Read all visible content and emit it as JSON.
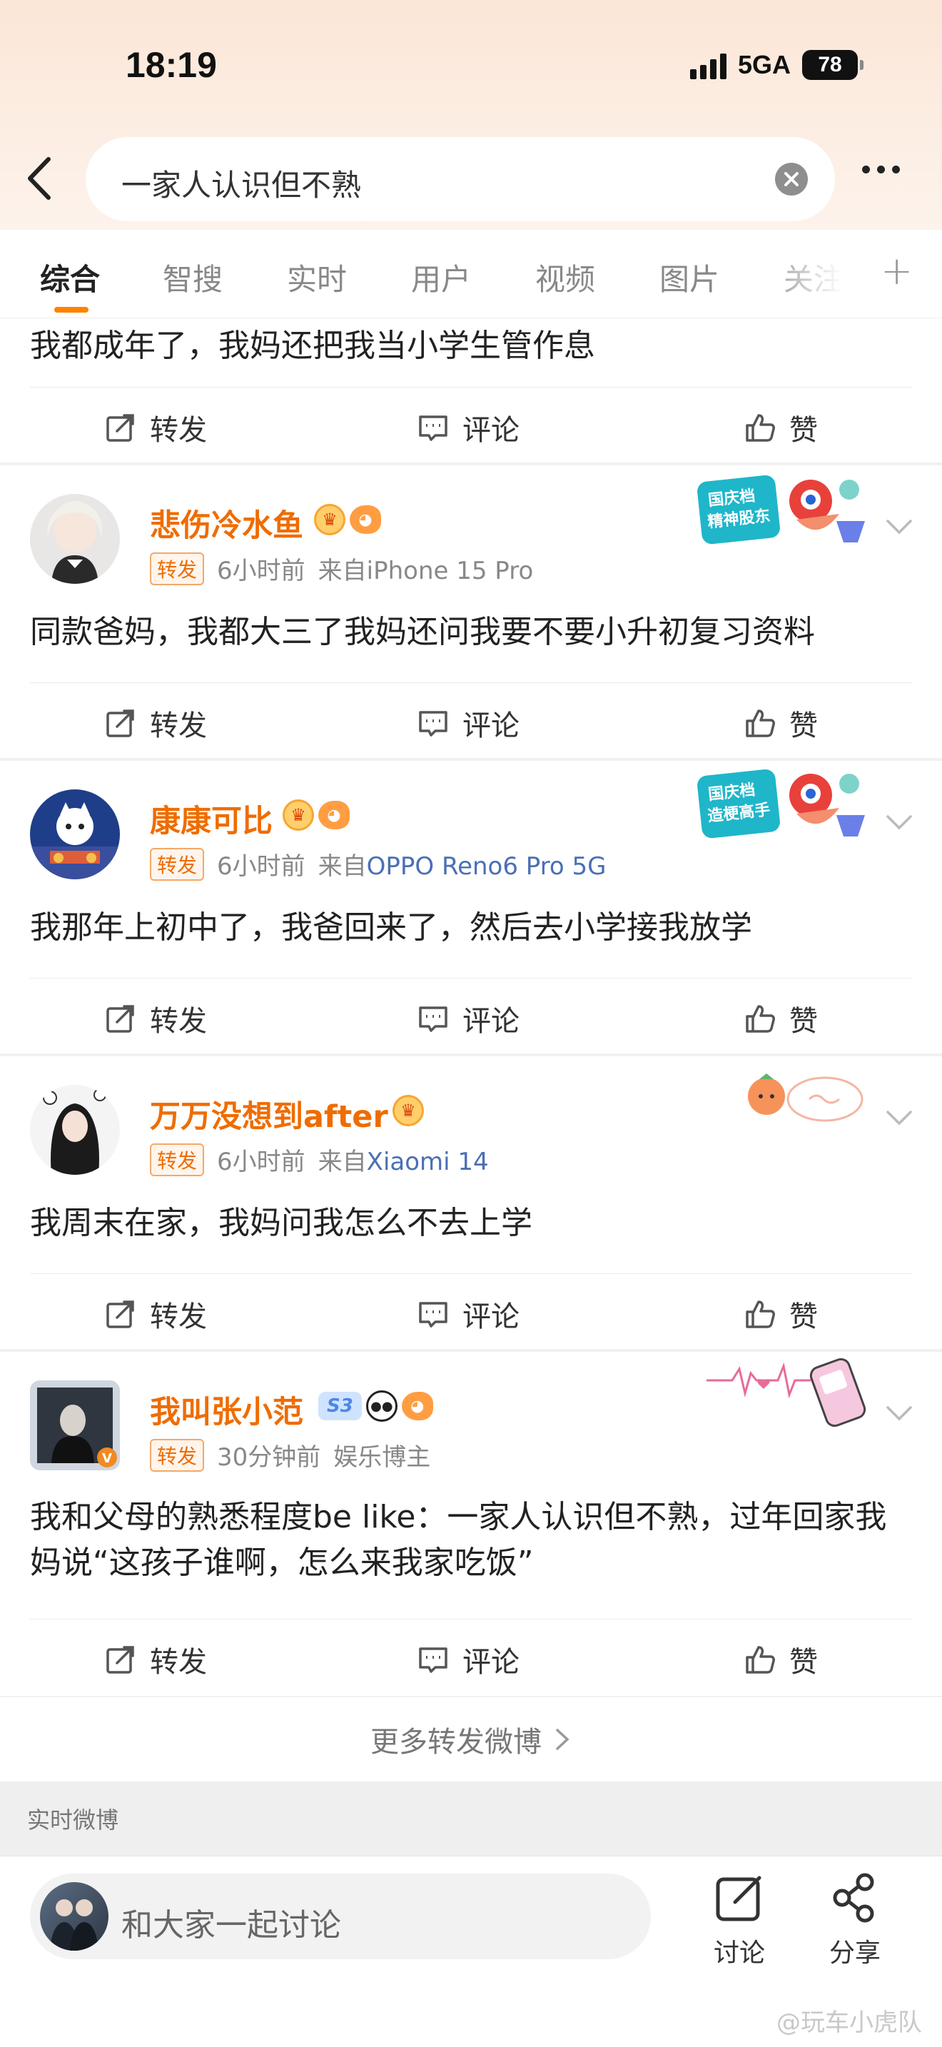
{
  "status_bar": {
    "time": "18:19",
    "network": "5GA",
    "battery": "78"
  },
  "search": {
    "query": "一家人认识但不熟"
  },
  "tabs": [
    {
      "label": "综合"
    },
    {
      "label": "智搜"
    },
    {
      "label": "实时"
    },
    {
      "label": "用户"
    },
    {
      "label": "视频"
    },
    {
      "label": "图片"
    },
    {
      "label": "关注"
    }
  ],
  "actions": {
    "forward": "转发",
    "comment": "评论",
    "like": "赞"
  },
  "top_post": {
    "text": "我都成年了，我妈还把我当小学生管作息"
  },
  "posts": [
    {
      "user": "悲伤冷水鱼",
      "tag": "转发",
      "time": "6小时前",
      "source": "来自iPhone 15 Pro",
      "text": "同款爸妈，我都大三了我妈还问我要不要小升初复习资料",
      "deco_line1": "国庆档",
      "deco_line2": "精神股东"
    },
    {
      "user": "康康可比",
      "tag": "转发",
      "time": "6小时前",
      "source": "来自OPPO Reno6 Pro 5G",
      "text": "我那年上初中了，我爸回来了，然后去小学接我放学",
      "deco_line1": "国庆档",
      "deco_line2": "造梗高手"
    },
    {
      "user": "万万没想到after",
      "tag": "转发",
      "time": "6小时前",
      "source": "来自Xiaomi 14",
      "text": "我周末在家，我妈问我怎么不去上学"
    },
    {
      "user": "我叫张小范",
      "tag": "转发",
      "time": "30分钟前",
      "source": "娱乐博主",
      "badge_level": "S3",
      "text": "我和父母的熟悉程度be like：一家人认识但不熟，过年回家我妈说“这孩子谁啊，怎么来我家吃饭”"
    }
  ],
  "more_forwards": "更多转发微博",
  "section_title": "实时微博",
  "bottom": {
    "placeholder": "和大家一起讨论",
    "discuss": "讨论",
    "share": "分享"
  },
  "watermark": "@玩车小虎队",
  "colors": {
    "accent": "#ff8200",
    "username": "#ef6c00",
    "source": "#4a6fb5"
  }
}
